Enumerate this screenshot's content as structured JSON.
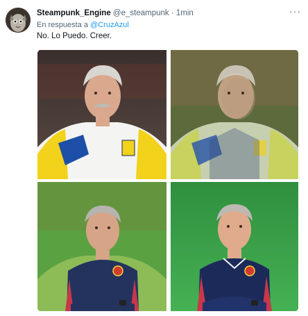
{
  "tweet": {
    "display_name": "Steampunk_Engine",
    "handle": "@e_steampunk",
    "separator": "·",
    "time": "1min",
    "more_label": "···",
    "reply_prefix": "En respuesta a",
    "reply_mention": "@CruzAzul",
    "text": "No. Lo Puedo. Creer."
  },
  "media": {
    "images": [
      {
        "name": "photo-1",
        "label_adidas": "adidas"
      },
      {
        "name": "photo-2",
        "label_adidas": "adidas"
      },
      {
        "name": "photo-3"
      },
      {
        "name": "photo-4"
      }
    ]
  },
  "colors": {
    "link": "#1d9bf0",
    "secondary_text": "#536471",
    "primary_text": "#0f1419",
    "jersey_yellow": "#f2d21b",
    "jersey_navy": "#1c2a5a",
    "grass_green": "#3aa64a"
  }
}
